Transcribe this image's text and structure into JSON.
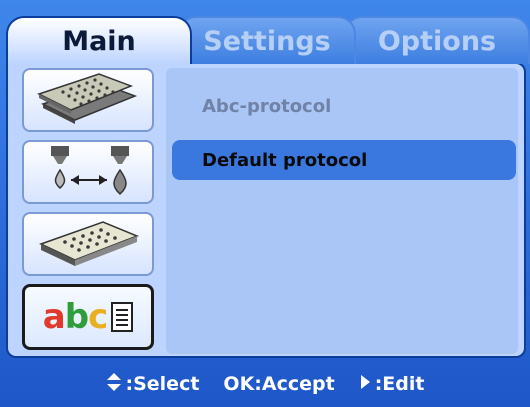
{
  "tabs": [
    {
      "label": "Main",
      "active": true
    },
    {
      "label": "Settings",
      "active": false
    },
    {
      "label": "Options",
      "active": false
    }
  ],
  "sidebar": {
    "items": [
      {
        "icon": "plate-stack-icon"
      },
      {
        "icon": "liquid-transfer-icon"
      },
      {
        "icon": "single-plate-icon"
      },
      {
        "icon": "protocol-name-icon",
        "icon_text": "abc",
        "selected": true
      }
    ]
  },
  "protocols": {
    "items": [
      {
        "label": "Abc-protocol",
        "selected": false
      },
      {
        "label": "Default protocol",
        "selected": true
      }
    ]
  },
  "footer": {
    "select": ":Select",
    "accept": "OK:Accept",
    "edit": ":Edit"
  },
  "colors": {
    "frame": "#2a6ad9",
    "panel": "#bcd4ff",
    "highlight": "#3a78e0",
    "dimmed_text": "#7082a6"
  }
}
